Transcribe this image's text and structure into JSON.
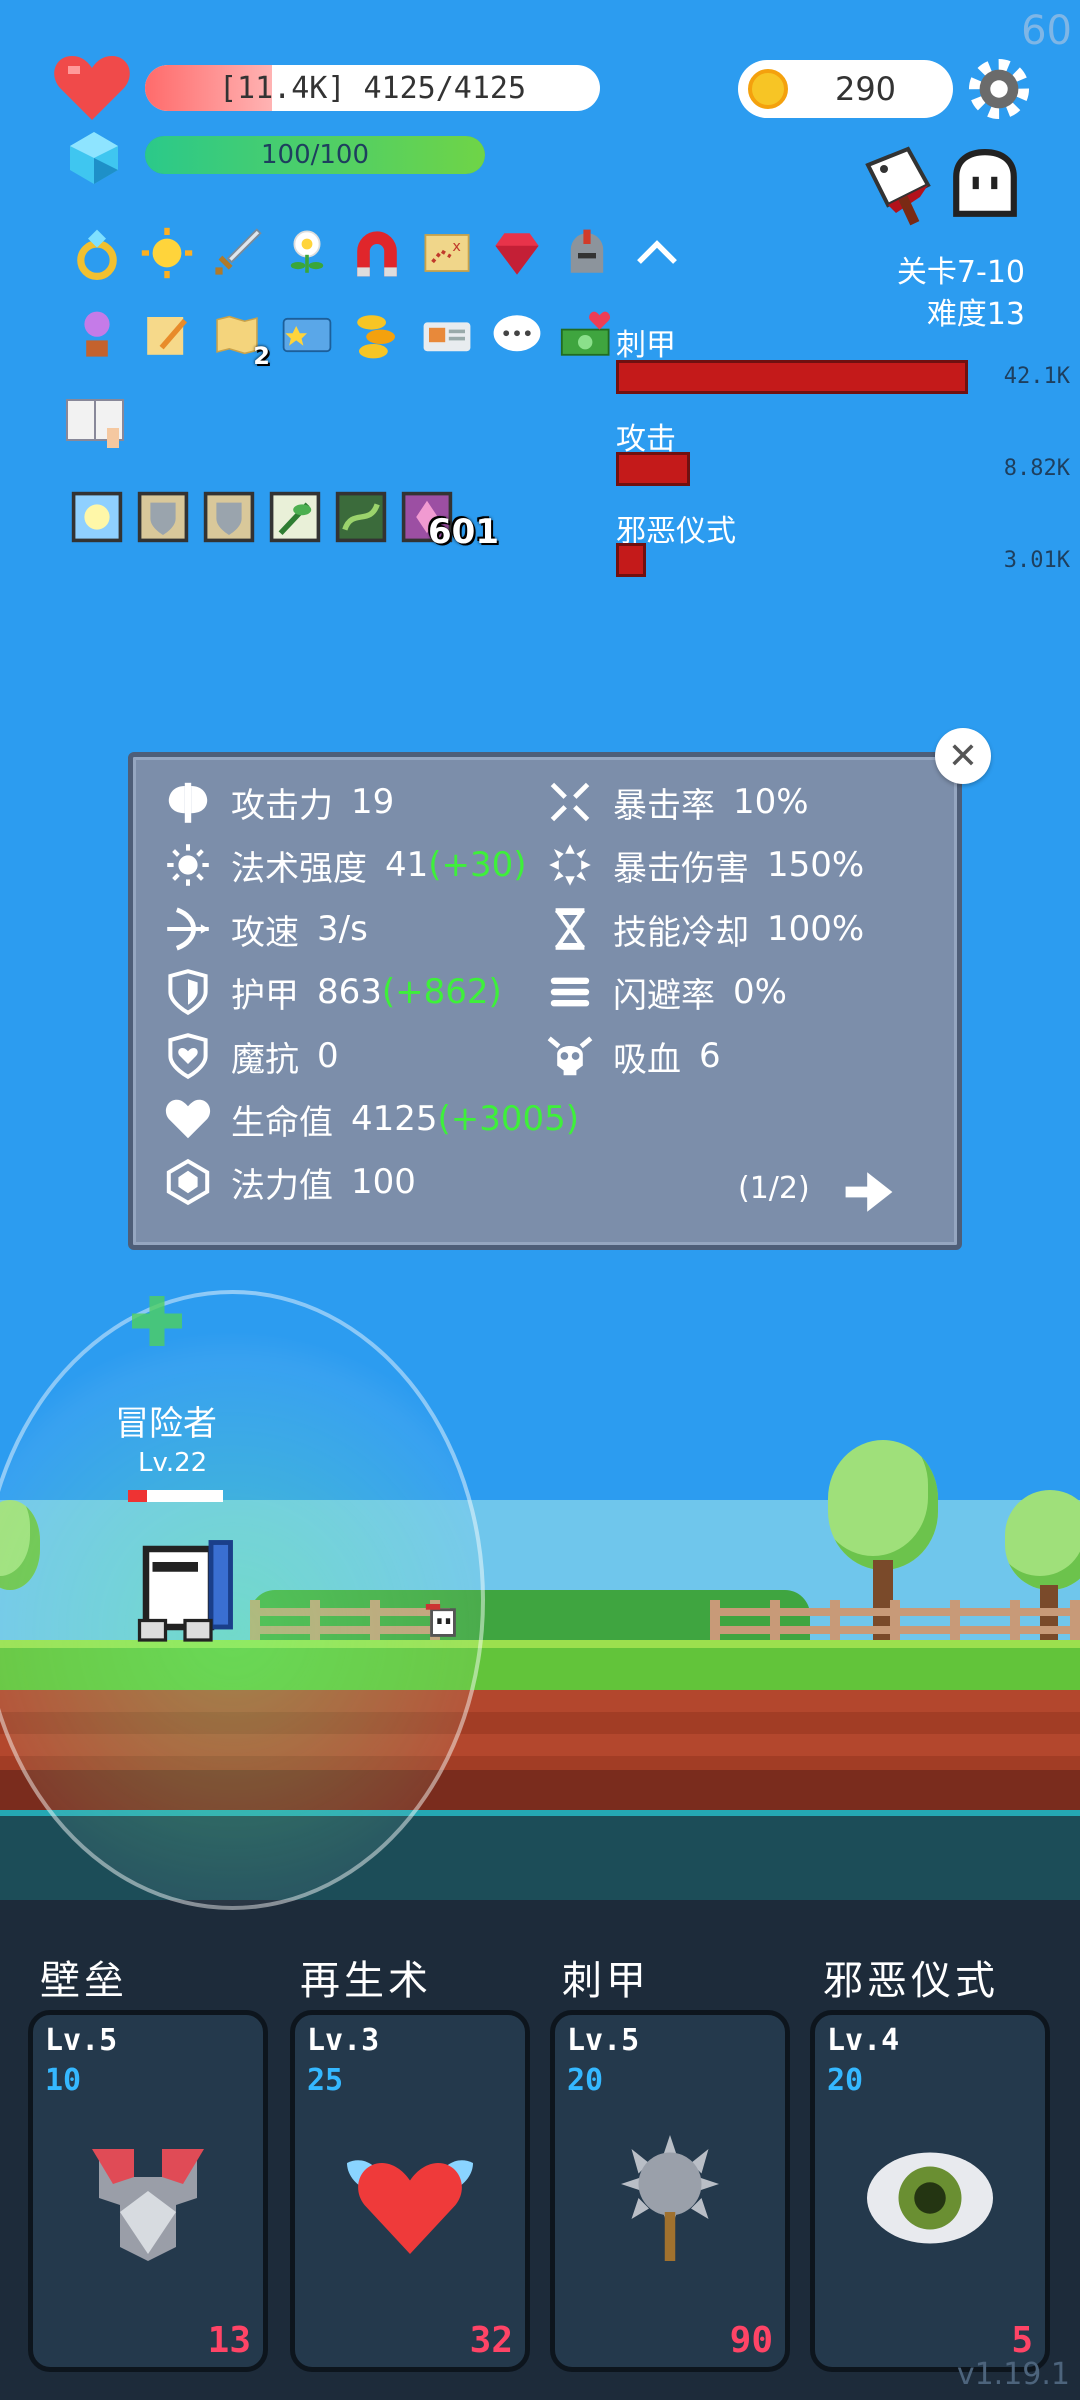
{
  "fps": "60",
  "player": {
    "hp_text": "[11.4K] 4125/4125",
    "hp_ratio": 1.0,
    "mana_text": "100/100",
    "mana_ratio": 1.0,
    "name": "冒险者",
    "level": "Lv.22",
    "battle_hp_ratio": 0.2
  },
  "gold": "290",
  "stage": {
    "level": "关卡7-10",
    "difficulty": "难度13"
  },
  "items": {
    "row1": [
      "ring-icon",
      "sun-icon",
      "sword-icon",
      "flower-icon",
      "magnet-icon",
      "treasure-map-icon",
      "ruby-icon",
      "helmet-icon",
      "chevron-up-icon"
    ],
    "row2": [
      "potted-flower-icon",
      "scroll-pencil-icon",
      "map-icon",
      "card-icon",
      "coins-stack-icon",
      "briefcase-card-icon",
      "chat-bubble-icon",
      "cash-heart-icon"
    ],
    "row2_badge": "2",
    "tome": "tome-icon",
    "row3": [
      "spark-card-icon",
      "shield-card-icon",
      "shield-card-icon",
      "sprout-card-icon",
      "vine-card-icon",
      "crystal-card-icon"
    ],
    "row3_badge": "601"
  },
  "damage_stats": [
    {
      "label": "刺甲",
      "value": "42.1K",
      "ratio": 1.0
    },
    {
      "label": "攻击",
      "value": "8.82K",
      "ratio": 0.21
    },
    {
      "label": "邪恶仪式",
      "value": "3.01K",
      "ratio": 0.07
    }
  ],
  "stats_panel": {
    "left": [
      {
        "icon": "axe-icon",
        "label": "攻击力",
        "value": "19",
        "bonus": ""
      },
      {
        "icon": "sun-icon",
        "label": "法术强度",
        "value": "41",
        "bonus": "(+30)"
      },
      {
        "icon": "bow-icon",
        "label": "攻速",
        "value": "3/s",
        "bonus": ""
      },
      {
        "icon": "shield-icon",
        "label": "护甲",
        "value": "863",
        "bonus": "(+862)"
      },
      {
        "icon": "heart-shield-icon",
        "label": "魔抗",
        "value": "0",
        "bonus": ""
      },
      {
        "icon": "heart-icon",
        "label": "生命值",
        "value": "4125",
        "bonus": "(+3005)"
      },
      {
        "icon": "gem-icon",
        "label": "法力值",
        "value": "100",
        "bonus": ""
      }
    ],
    "right": [
      {
        "icon": "crit-icon",
        "label": "暴击率",
        "value": "10%"
      },
      {
        "icon": "crit-damage-icon",
        "label": "暴击伤害",
        "value": "150%"
      },
      {
        "icon": "hourglass-icon",
        "label": "技能冷却",
        "value": "100%"
      },
      {
        "icon": "dodge-icon",
        "label": "闪避率",
        "value": "0%"
      },
      {
        "icon": "skull-icon",
        "label": "吸血",
        "value": "6"
      }
    ],
    "page": "(1/2)"
  },
  "skills": [
    {
      "name": "壁垒",
      "level": "Lv.5",
      "cost": "10",
      "count": "13",
      "icon": "armor-icon"
    },
    {
      "name": "再生术",
      "level": "Lv.3",
      "cost": "25",
      "count": "32",
      "icon": "winged-heart-icon"
    },
    {
      "name": "刺甲",
      "level": "Lv.5",
      "cost": "20",
      "count": "90",
      "icon": "spiked-mace-icon"
    },
    {
      "name": "邪恶仪式",
      "level": "Lv.4",
      "cost": "20",
      "count": "5",
      "icon": "eye-icon"
    }
  ],
  "version": "v1.19.1",
  "colors": {
    "sky": "#2c9cf0",
    "damage_bar": "#c41a1a",
    "bonus": "#3ef03a",
    "panel": "#7c8eaa"
  }
}
